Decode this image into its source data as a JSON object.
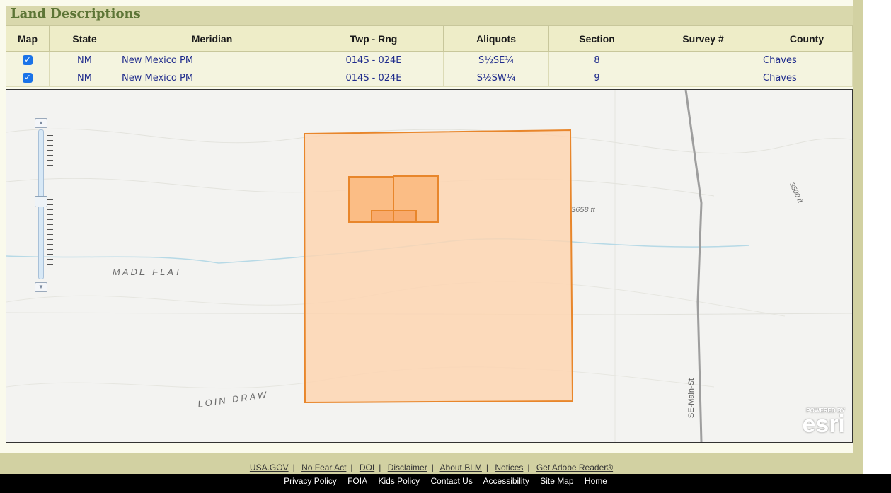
{
  "section": {
    "title": "Land Descriptions"
  },
  "table": {
    "headers": [
      "Map",
      "State",
      "Meridian",
      "Twp - Rng",
      "Aliquots",
      "Section",
      "Survey #",
      "County"
    ],
    "rows": [
      {
        "checked": true,
        "state": "NM",
        "meridian": "New Mexico PM",
        "twp_rng": "014S - 024E",
        "aliquots": "S½SE¼",
        "section": "8",
        "survey": "",
        "county": "Chaves"
      },
      {
        "checked": true,
        "state": "NM",
        "meridian": "New Mexico PM",
        "twp_rng": "014S - 024E",
        "aliquots": "S½SW¼",
        "section": "9",
        "survey": "",
        "county": "Chaves"
      }
    ]
  },
  "map": {
    "labels": {
      "made_flat": "MADE FLAT",
      "loin_draw": "LOIN DRAW",
      "elev1": "3658 ft",
      "elev2": "3500 ft",
      "road": "SE-Main-St"
    },
    "attribution": {
      "powered_by": "POWERED BY",
      "brand": "esri"
    },
    "colors": {
      "fill": "#fdd5b1",
      "stroke": "#e8862b"
    }
  },
  "footer": {
    "row1": [
      "USA.GOV",
      "No Fear Act",
      "DOI",
      "Disclaimer",
      "About BLM",
      "Notices",
      "Get Adobe Reader®"
    ],
    "row2": [
      "Privacy Policy",
      "FOIA",
      "Kids Policy",
      "Contact Us",
      "Accessibility",
      "Site Map",
      "Home"
    ]
  }
}
